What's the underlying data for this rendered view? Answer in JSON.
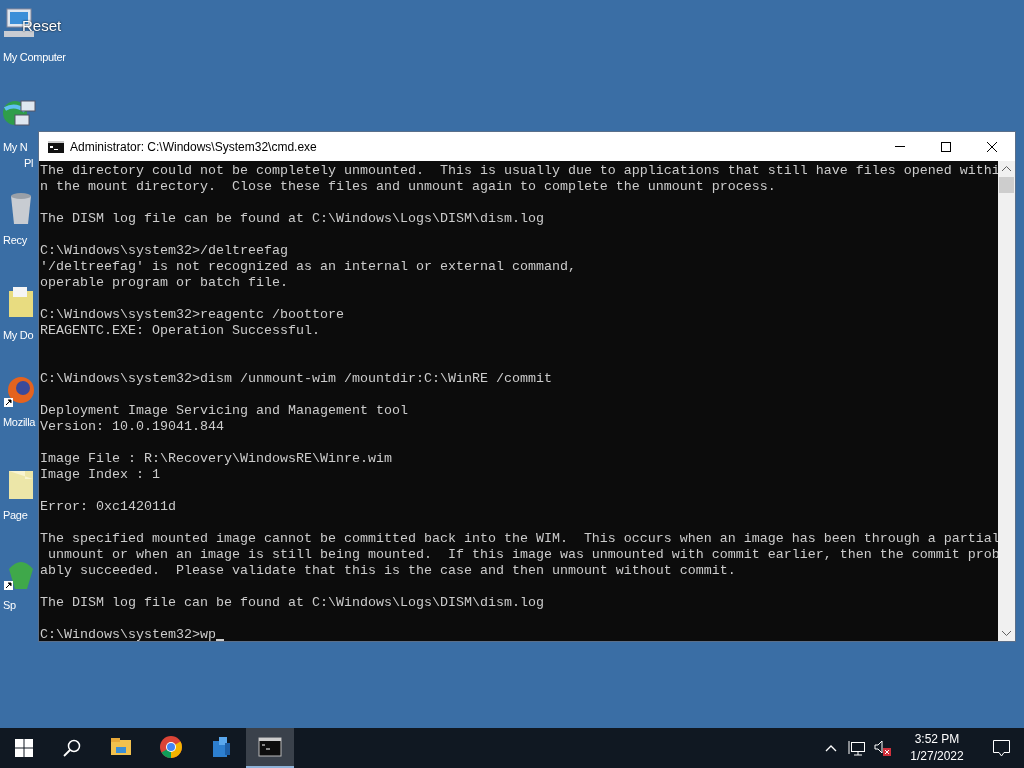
{
  "desktop_icons": [
    {
      "kind": "computer",
      "overlay": "Reset",
      "label_lines": [
        "My Computer"
      ]
    },
    {
      "kind": "network",
      "label_lines": [
        "My N",
        "Pl"
      ]
    },
    {
      "kind": "recycle",
      "label_lines": [
        "Recy"
      ]
    },
    {
      "kind": "documents",
      "label_lines": [
        "My Do"
      ]
    },
    {
      "kind": "browser",
      "label_lines": [
        "Mozilla"
      ]
    },
    {
      "kind": "page",
      "label_lines": [
        "Page"
      ]
    },
    {
      "kind": "app",
      "label_lines": [
        "Sp"
      ]
    }
  ],
  "window": {
    "title": "Administrator: C:\\Windows\\System32\\cmd.exe",
    "blocks": [
      {
        "lines": [
          "The directory could not be completely unmounted.  This is usually due to applications that still have files opened withi",
          "n the mount directory.  Close these files and unmount again to complete the unmount process."
        ]
      },
      {
        "kind": "spaced",
        "lines": [
          "The DISM log file can be found at C:\\Windows\\Logs\\DISM\\dism.log"
        ]
      },
      {
        "kind": "spaced",
        "lines": [
          "C:\\Windows\\system32>/deltreefag",
          "'/deltreefag' is not recognized as an internal or external command,",
          "operable program or batch file."
        ]
      },
      {
        "kind": "spaced",
        "lines": [
          "C:\\Windows\\system32>reagentc /boottore",
          "REAGENTC.EXE: Operation Successful."
        ]
      },
      {
        "kind": "double_spaced",
        "lines": [
          "C:\\Windows\\system32>dism /unmount-wim /mountdir:C:\\WinRE /commit"
        ]
      },
      {
        "kind": "spaced",
        "lines": [
          "Deployment Image Servicing and Management tool",
          "Version: 10.0.19041.844"
        ]
      },
      {
        "kind": "spaced",
        "lines": [
          "Image File : R:\\Recovery\\WindowsRE\\Winre.wim",
          "Image Index : 1"
        ]
      },
      {
        "kind": "spaced",
        "lines": [
          "Error: 0xc142011d"
        ]
      },
      {
        "kind": "spaced",
        "lines": [
          "The specified mounted image cannot be committed back into the WIM.  This occurs when an image has been through a partial",
          " unmount or when an image is still being mounted.  If this image was unmounted with commit earlier, then the commit prob",
          "ably succeeded.  Please validate that this is the case and then unmount without commit."
        ]
      },
      {
        "kind": "spaced",
        "lines": [
          "The DISM log file can be found at C:\\Windows\\Logs\\DISM\\dism.log"
        ]
      },
      {
        "kind": "spaced",
        "cursor": true,
        "lines": [
          "C:\\Windows\\system32>wp"
        ]
      }
    ]
  },
  "taskbar": {
    "apps": [
      {
        "kind": "explorer",
        "selected": false
      },
      {
        "kind": "chrome",
        "selected": false
      },
      {
        "kind": "cube",
        "selected": false
      },
      {
        "kind": "terminal",
        "selected": true
      }
    ],
    "clock": {
      "time": "3:52 PM",
      "date": "1/27/2022"
    }
  }
}
